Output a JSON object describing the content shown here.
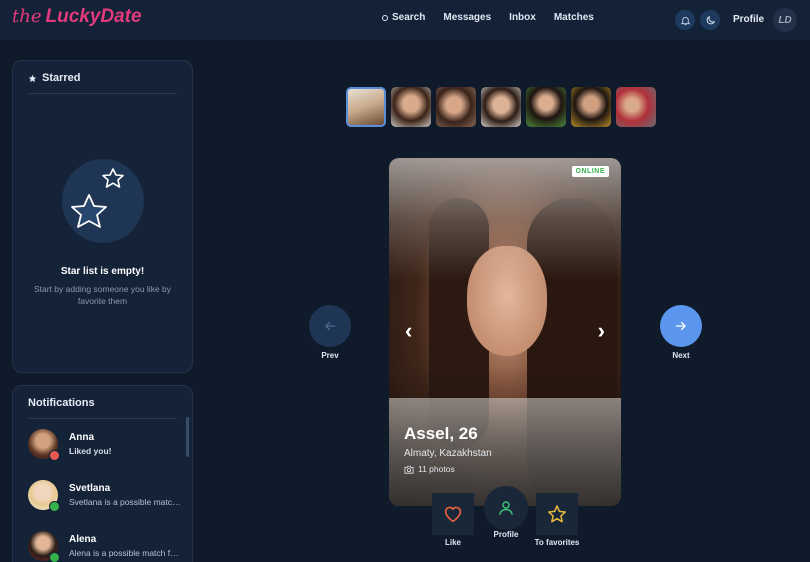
{
  "header": {
    "logo_prefix": "the",
    "logo_name": "LuckyDate",
    "nav": [
      "Search",
      "Messages",
      "Inbox",
      "Matches"
    ],
    "profile_label": "Profile",
    "avatar_initials": "LD"
  },
  "starred": {
    "title": "Starred",
    "empty_title": "Star list is empty!",
    "empty_sub": "Start by adding someone you like by favorite them"
  },
  "notifications": {
    "title": "Notifications",
    "items": [
      {
        "name": "Anna",
        "message": "Liked you!"
      },
      {
        "name": "Svetlana",
        "message": "Svetlana is a possible match for you"
      },
      {
        "name": "Alena",
        "message": "Alena is a possible match for you"
      }
    ]
  },
  "card": {
    "status": "ONLINE",
    "name": "Assel, 26",
    "location": "Almaty, Kazakhstan",
    "photos": "11 photos"
  },
  "controls": {
    "prev": "Prev",
    "next": "Next",
    "like": "Like",
    "profile": "Profile",
    "favorites": "To favorites"
  },
  "colors": {
    "background": "#0f1a2b",
    "header": "#142238",
    "brand": "#e23a7d",
    "accent": "#5a95ee",
    "online": "#36b24a"
  }
}
